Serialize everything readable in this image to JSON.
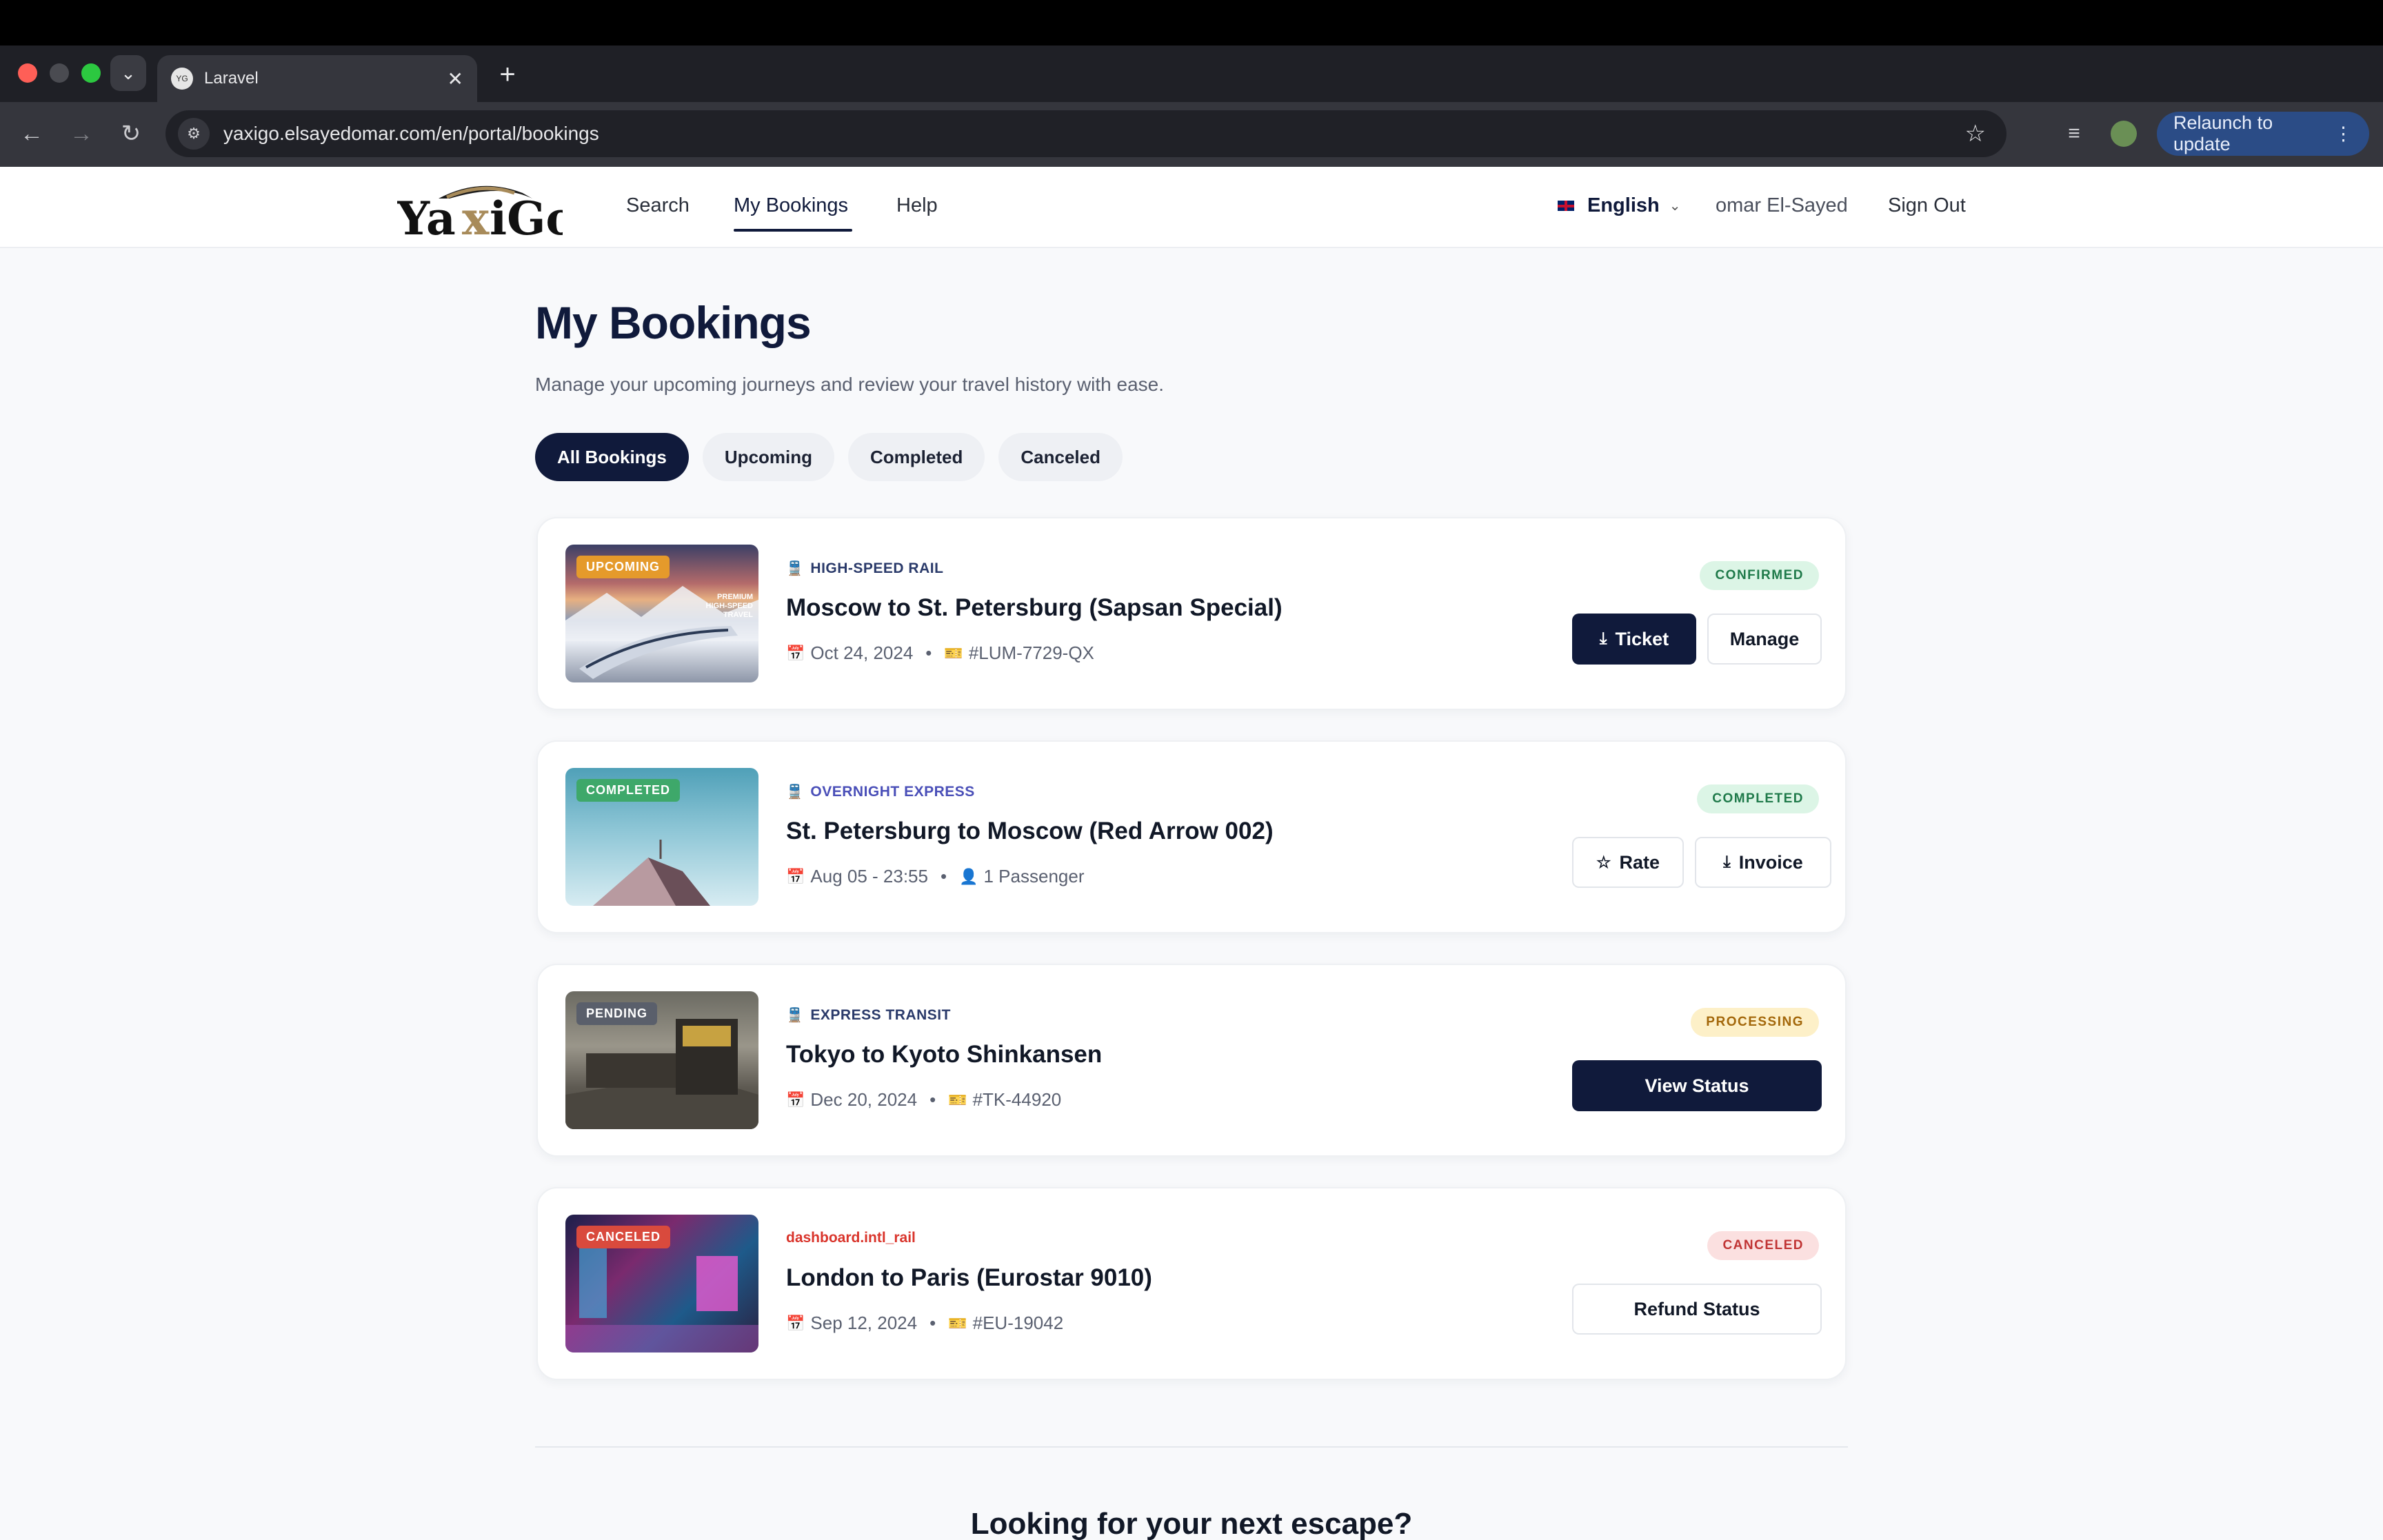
{
  "browser": {
    "tab_title": "Laravel",
    "favicon_text": "YG",
    "url": "yaxigo.elsayedomar.com/en/portal/bookings",
    "relaunch_label": "Relaunch to update"
  },
  "header": {
    "logo_text": "YaxiGo",
    "nav": {
      "search": "Search",
      "my_bookings": "My Bookings",
      "help": "Help"
    },
    "language": "English",
    "user_name": "omar El-Sayed",
    "sign_out": "Sign Out"
  },
  "page": {
    "title": "My Bookings",
    "subtitle": "Manage your upcoming journeys and review your travel history with ease.",
    "filters": [
      "All Bookings",
      "Upcoming",
      "Completed",
      "Canceled"
    ],
    "active_filter": "All Bookings"
  },
  "bookings": [
    {
      "thumb_badge": "UPCOMING",
      "thumb_caption": "PREMIUM HIGH-SPEED TRAVEL",
      "category": "HIGH-SPEED RAIL",
      "route": "Moscow to St. Petersburg (Sapsan Special)",
      "date": "Oct 24, 2024",
      "detail": "#LUM-7729-QX",
      "status": "CONFIRMED",
      "primary_action": "Ticket",
      "secondary_action": "Manage"
    },
    {
      "thumb_badge": "COMPLETED",
      "category": "OVERNIGHT EXPRESS",
      "route": "St. Petersburg to Moscow (Red Arrow 002)",
      "date": "Aug 05 - 23:55",
      "detail": "1 Passenger",
      "status": "COMPLETED",
      "primary_action": "Rate",
      "secondary_action": "Invoice"
    },
    {
      "thumb_badge": "PENDING",
      "category": "EXPRESS TRANSIT",
      "route": "Tokyo to Kyoto Shinkansen",
      "date": "Dec 20, 2024",
      "detail": "#TK-44920",
      "status": "PROCESSING",
      "primary_action": "View Status"
    },
    {
      "thumb_badge": "CANCELED",
      "category": "dashboard.intl_rail",
      "route": "London to Paris (Eurostar 9010)",
      "date": "Sep 12, 2024",
      "detail": "#EU-19042",
      "status": "CANCELED",
      "primary_action": "Refund Status"
    }
  ],
  "footer_heading": "Looking for your next escape?",
  "colors": {
    "brand_navy": "#101a3b",
    "confirmed_bg": "#dcf5e6",
    "confirmed_fg": "#1f7a4a",
    "processing_bg": "#fdf0c8",
    "processing_fg": "#a3670a",
    "canceled_bg": "#fbe0e0",
    "canceled_fg": "#c03434",
    "badge_upcoming": "#e59a2b",
    "badge_completed": "#3ea86a",
    "badge_pending": "#5a5f6b",
    "badge_canceled": "#d94a3d"
  }
}
